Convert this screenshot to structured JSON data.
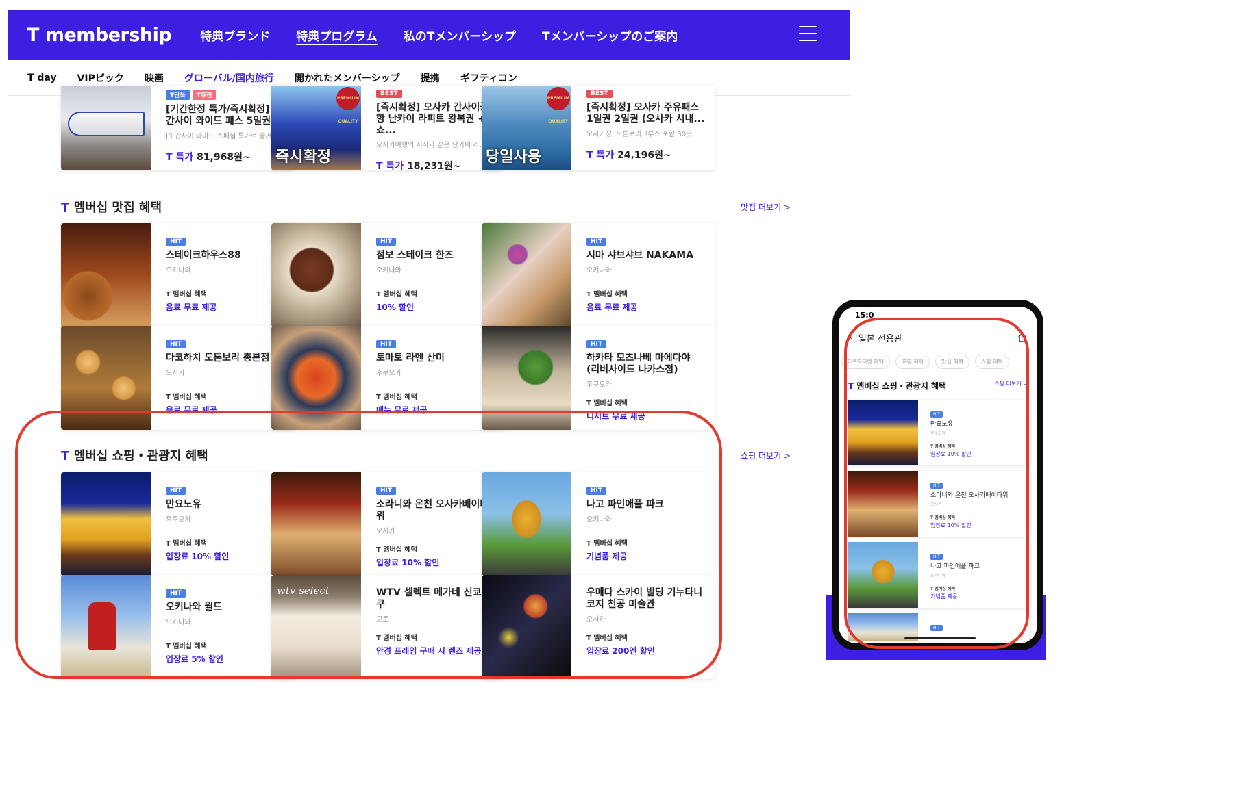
{
  "header": {
    "logo": "T membership",
    "nav": [
      "特典ブランド",
      "特典プログラム",
      "私のTメンバーシップ",
      "Tメンバーシップのご案内"
    ],
    "active_nav": 1
  },
  "subnav": {
    "items": [
      "T day",
      "VIPピック",
      "映画",
      "グローバル/国内旅行",
      "開かれたメンバーシップ",
      "提携",
      "ギフティコン"
    ],
    "active": 3
  },
  "travel": {
    "cards": [
      {
        "badges": [
          "T단독",
          "T추천"
        ],
        "title": "[기간한정 특가/즉시확정] JR 간사이 와이드 패스 5일권",
        "desc": "JR 간사이 와이드 스페셜 특가로 즐거...",
        "price_label": "T 특가",
        "price": "81,968원~"
      },
      {
        "badges": [
          "BEST"
        ],
        "title": "[즉시확정] 오사카 간사이공항 난카이 라피트 왕복권 + 쇼...",
        "desc": "오사카여행의 시작과 끝은 난카이 라...",
        "price_label": "T 특가",
        "price": "18,231원~",
        "thumb_text": "즉시확정",
        "premium": "PREMIUM QUALITY"
      },
      {
        "badges": [
          "BEST"
        ],
        "title": "[즉시확정] 오사카 주유패스 1일권 2일권 (오사카 시내...",
        "desc": "오사카성, 도톤보리크루즈 포함 30곳 ...",
        "price_label": "T 특가",
        "price": "24,196원~",
        "thumb_text": "당일사용",
        "premium": "PREMIUM QUALITY"
      }
    ]
  },
  "restaurants": {
    "title_prefix": "T",
    "title_rest": "멤버십 맛집 혜택",
    "more": "맛집 더보기 >",
    "cards": [
      {
        "badge": "HIT",
        "title": "스테이크하우스88",
        "loc": "오키나와",
        "label": "T 멤버십 혜택",
        "benefit": "음료 무료 제공"
      },
      {
        "badge": "HIT",
        "title": "점보 스테이크 한즈",
        "loc": "오키나와",
        "label": "T 멤버십 혜택",
        "benefit": "10% 할인"
      },
      {
        "badge": "HIT",
        "title": "시마 샤브샤브 NAKAMA",
        "loc": "오키나와",
        "label": "T 멤버십 혜택",
        "benefit": "음료 무료 제공"
      },
      {
        "badge": "HIT",
        "title": "다코하치 도톤보리 총본점",
        "loc": "오사카",
        "label": "T 멤버십 혜택",
        "benefit": "음료 무료 제공"
      },
      {
        "badge": "HIT",
        "title": "토마토 라멘 산미",
        "loc": "후쿠오카",
        "label": "T 멤버십 혜택",
        "benefit": "메뉴 무료 제공"
      },
      {
        "badge": "HIT",
        "title": "하카타 모츠나베 마에다야 (리버사이드 나카스점)",
        "loc": "후쿠오카",
        "label": "T 멤버십 혜택",
        "benefit": "디저트 무료 제공"
      }
    ]
  },
  "shopping": {
    "title_prefix": "T",
    "title_rest": "멤버십 쇼핑・관광지 혜택",
    "more": "쇼핑 더보기 >",
    "cards": [
      {
        "badge": "HIT",
        "title": "만요노유",
        "loc": "후쿠오카",
        "label": "T 멤버십 혜택",
        "benefit": "입장료 10% 할인"
      },
      {
        "badge": "HIT",
        "title": "소라니와 온천 오사카베이타워",
        "loc": "오사카",
        "label": "T 멤버십 혜택",
        "benefit": "입장료 10% 할인"
      },
      {
        "badge": "HIT",
        "title": "나고 파인애플 파크",
        "loc": "오키나와",
        "label": "T 멤버십 혜택",
        "benefit": "기념품 제공"
      },
      {
        "badge": "HIT",
        "title": "오키나와 월드",
        "loc": "오키나와",
        "label": "T 멤버십 혜택",
        "benefit": "입장료 5% 할인"
      },
      {
        "badge": "",
        "title": "WTV 셀렉트 메가네 신쿄고쿠",
        "loc": "교토",
        "label": "T 멤버십 혜택",
        "benefit": "안경 프레임 구매 시 렌즈 제공",
        "thumb_text": "wtv select"
      },
      {
        "badge": "",
        "title": "우메다 스카이 빌딩 기누타니 코지 천공 미술관",
        "loc": "오사카",
        "label": "T 멤버십 혜택",
        "benefit": "입장료 200엔 할인"
      }
    ]
  },
  "phone": {
    "time": "15:0",
    "title": "일본 전용관",
    "tabs": [
      "어트&티켓 혜택",
      "교통 혜택",
      "맛집 혜택",
      "쇼핑 혜택"
    ],
    "section_prefix": "T",
    "section_rest": "멤버십 쇼핑・관광지 혜택",
    "more": "쇼핑 더보기 >",
    "cards": [
      {
        "badge": "HIT",
        "title": "만요노유",
        "loc": "후쿠오카",
        "label": "T 멤버십 혜택",
        "benefit": "입장료 10% 할인"
      },
      {
        "badge": "HIT",
        "title": "소라니와 온천 오사카베이타워",
        "loc": "오사카",
        "label": "T 멤버십 혜택",
        "benefit": "입장료 10% 할인"
      },
      {
        "badge": "HIT",
        "title": "나고 파인애플 파크",
        "loc": "오키나와",
        "label": "T 멤버십 혜택",
        "benefit": "기념품 제공"
      },
      {
        "badge": "HIT"
      }
    ]
  },
  "colors": {
    "brand": "#3c1fe0",
    "highlight": "#e23a2e",
    "badge": "#4a7de8"
  }
}
